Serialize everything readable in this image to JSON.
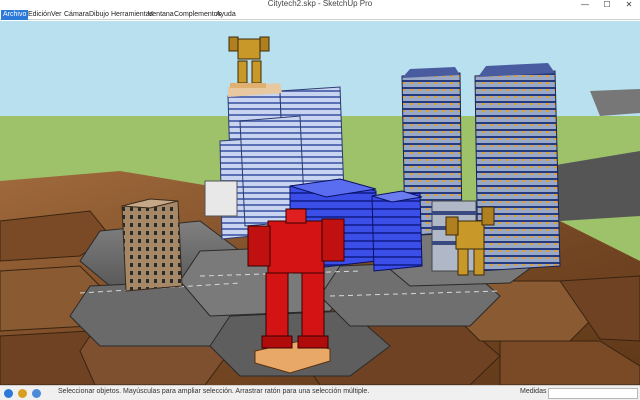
{
  "window": {
    "title": "Citytech2.skp - SketchUp Pro",
    "minimize_glyph": "—",
    "maximize_glyph": "☐",
    "close_glyph": "✕"
  },
  "menu": {
    "items": [
      "Archivo",
      "Edición",
      "Ver",
      "Cámara",
      "Dibujo",
      "Herramientas",
      "Ventana",
      "Complementos",
      "Ayuda"
    ],
    "active_index": 0,
    "accent": "#2b79d8"
  },
  "viewport": {
    "sky_color": "#b8e0ee",
    "ground_color": "#9ec26a",
    "road_color": "#6f6f6f",
    "hex_wood_color": "#8a5a32",
    "building_colors": {
      "blue": "#3b4fe8",
      "light_blue": "#b9c8ea",
      "brick": "#a48868"
    },
    "mech_colors": {
      "red": "#d41414",
      "yellow": "#c89828"
    }
  },
  "status": {
    "icons": [
      "info-icon",
      "user-icon",
      "help-icon"
    ],
    "text": "Seleccionar objetos. Mayúsculas para ampliar selección. Arrastrar ratón para una selección múltiple.",
    "measure_label": "Medidas",
    "measure_value": ""
  }
}
